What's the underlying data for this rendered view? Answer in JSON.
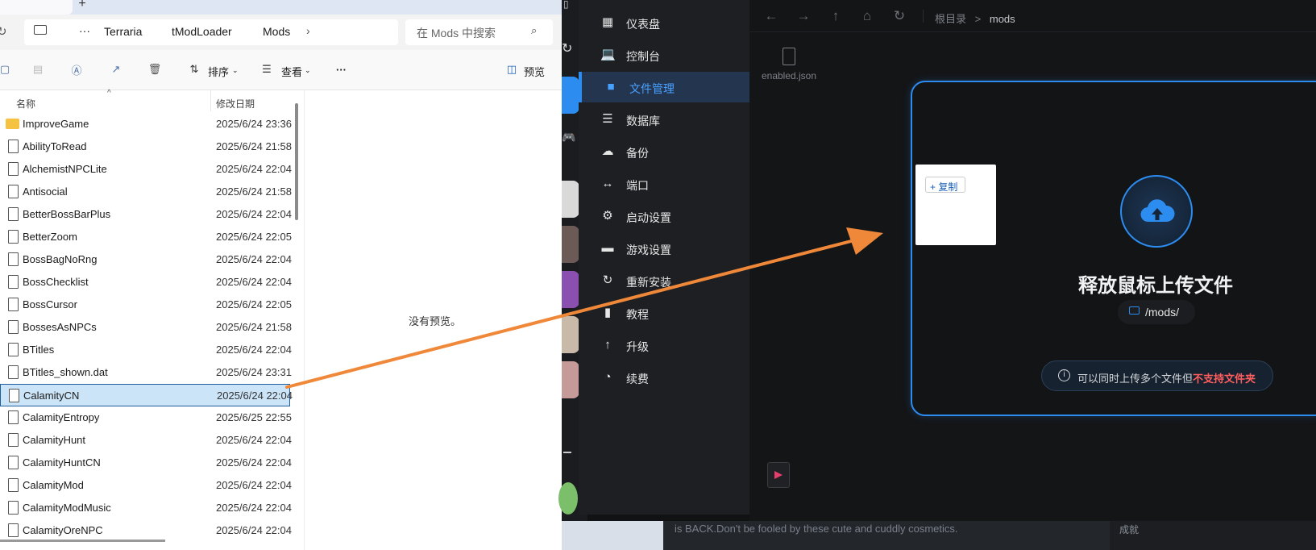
{
  "explorer": {
    "breadcrumb": [
      "Terraria",
      "tModLoader",
      "Mods"
    ],
    "ellipsis": "···",
    "search_placeholder": "在 Mods 中搜索",
    "toolbar": {
      "sort_label": "排序",
      "view_label": "查看",
      "more_label": "···",
      "preview_label": "预览"
    },
    "columns": {
      "name": "名称",
      "date": "修改日期"
    },
    "files": [
      {
        "name": "ImproveGame",
        "date": "2025/6/24 23:36",
        "type": "folder"
      },
      {
        "name": "AbilityToRead",
        "date": "2025/6/24 21:58",
        "type": "file"
      },
      {
        "name": "AlchemistNPCLite",
        "date": "2025/6/24 22:04",
        "type": "file"
      },
      {
        "name": "Antisocial",
        "date": "2025/6/24 21:58",
        "type": "file"
      },
      {
        "name": "BetterBossBarPlus",
        "date": "2025/6/24 22:04",
        "type": "file"
      },
      {
        "name": "BetterZoom",
        "date": "2025/6/24 22:05",
        "type": "file"
      },
      {
        "name": "BossBagNoRng",
        "date": "2025/6/24 22:04",
        "type": "file"
      },
      {
        "name": "BossChecklist",
        "date": "2025/6/24 22:04",
        "type": "file"
      },
      {
        "name": "BossCursor",
        "date": "2025/6/24 22:05",
        "type": "file"
      },
      {
        "name": "BossesAsNPCs",
        "date": "2025/6/24 21:58",
        "type": "file"
      },
      {
        "name": "BTitles",
        "date": "2025/6/24 22:04",
        "type": "file"
      },
      {
        "name": "BTitles_shown.dat",
        "date": "2025/6/24 23:31",
        "type": "file"
      },
      {
        "name": "CalamityCN",
        "date": "2025/6/24 22:04",
        "type": "file",
        "selected": true
      },
      {
        "name": "CalamityEntropy",
        "date": "2025/6/25 22:55",
        "type": "file"
      },
      {
        "name": "CalamityHunt",
        "date": "2025/6/24 22:04",
        "type": "file"
      },
      {
        "name": "CalamityHuntCN",
        "date": "2025/6/24 22:04",
        "type": "file"
      },
      {
        "name": "CalamityMod",
        "date": "2025/6/24 22:04",
        "type": "file"
      },
      {
        "name": "CalamityModMusic",
        "date": "2025/6/24 22:04",
        "type": "file"
      },
      {
        "name": "CalamityOreNPC",
        "date": "2025/6/24 22:04",
        "type": "file"
      }
    ],
    "no_preview": "没有预览。"
  },
  "sidebar": {
    "items": [
      {
        "label": "仪表盘",
        "icon": "dashboard-icon"
      },
      {
        "label": "控制台",
        "icon": "laptop-icon"
      },
      {
        "label": "文件管理",
        "icon": "folder-icon",
        "active": true
      },
      {
        "label": "数据库",
        "icon": "database-icon"
      },
      {
        "label": "备份",
        "icon": "cloud-upload-icon"
      },
      {
        "label": "端口",
        "icon": "port-icon"
      },
      {
        "label": "启动设置",
        "icon": "gear-icon"
      },
      {
        "label": "游戏设置",
        "icon": "gamepad-icon"
      },
      {
        "label": "重新安装",
        "icon": "refresh-icon"
      },
      {
        "label": "教程",
        "icon": "book-icon"
      },
      {
        "label": "升级",
        "icon": "upgrade-icon"
      },
      {
        "label": "续费",
        "icon": "renew-icon"
      }
    ]
  },
  "filemanager": {
    "breadcrumb_root": "根目录",
    "breadcrumb_sep": ">",
    "breadcrumb_current": "mods",
    "file_name": "enabled.json",
    "upload_title": "释放鼠标上传文件",
    "upload_path": "/mods/",
    "tip_normal": "可以同时上传多个文件但",
    "tip_warn": "不支持文件夹",
    "drag_badge": "+ 复制"
  },
  "web": {
    "text": "is BACK.Don't be fooled by these cute and cuddly cosmetics.",
    "right_text": "成就"
  },
  "colors": {
    "accent": "#2d8cf0",
    "arrow": "#f0883a",
    "warn": "#ff5e5e"
  }
}
